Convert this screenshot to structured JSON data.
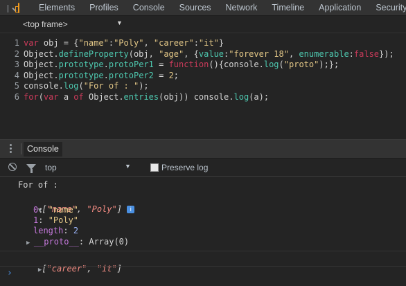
{
  "toolbar": {
    "tabs": [
      "Elements",
      "Profiles",
      "Console",
      "Sources",
      "Network",
      "Timeline",
      "Application",
      "Security"
    ]
  },
  "frame_selector": {
    "label": "<top frame>"
  },
  "editor": {
    "line_numbers": [
      "1",
      "2",
      "3",
      "4",
      "5",
      "6"
    ]
  },
  "drawer": {
    "tab_label": "Console"
  },
  "filter": {
    "context": "top",
    "preserve_log_label": "Preserve log",
    "preserve_log_checked": false
  },
  "console_output": {
    "line1": "For of :",
    "array1_open": "[",
    "array1_item1": "\"name\"",
    "array1_sep": ", ",
    "array1_item2": "\"Poly\"",
    "array1_close": "]",
    "info_badge": "i",
    "prop0_key": "0",
    "prop0_val": "\"name\"",
    "prop1_key": "1",
    "prop1_val": "\"Poly\"",
    "length_key": "length",
    "length_val": "2",
    "proto_key": "__proto__",
    "proto_val": "Array(0)",
    "array2_open": "[",
    "array2_item1": "\"career\"",
    "array2_sep": ", ",
    "array2_item2": "\"it\"",
    "array2_close": "]",
    "prompt": "›"
  },
  "colors": {
    "keyword": "#cc3b5b",
    "string": "#e3c787",
    "function": "#4ec9b0",
    "accent": "#4a90e2"
  }
}
